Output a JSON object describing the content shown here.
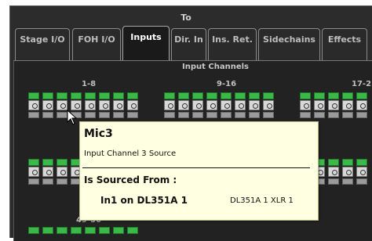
{
  "header": {
    "to_label": "To"
  },
  "tabs": [
    {
      "label": "Stage I/O",
      "active": false
    },
    {
      "label": "FOH I/O",
      "active": false
    },
    {
      "label": "Inputs",
      "active": true
    },
    {
      "label": "Dir. In",
      "active": false
    },
    {
      "label": "Ins. Ret.",
      "active": false
    },
    {
      "label": "Sidechains",
      "active": false
    },
    {
      "label": "Effects",
      "active": false
    }
  ],
  "panel": {
    "title": "Input Channels",
    "groups": [
      {
        "label": "1-8"
      },
      {
        "label": "9-16"
      },
      {
        "label": "17-2"
      },
      {
        "label": "49-56"
      }
    ]
  },
  "tooltip": {
    "name": "Mic3",
    "description": "Input Channel 3 Source",
    "sourced_heading": "Is Sourced From :",
    "source": "In1 on DL351A 1",
    "port": "DL351A 1 XLR 1"
  },
  "colors": {
    "channel_green": "#3cb84a",
    "tooltip_bg": "#ffffe2",
    "panel_bg": "#222222"
  }
}
